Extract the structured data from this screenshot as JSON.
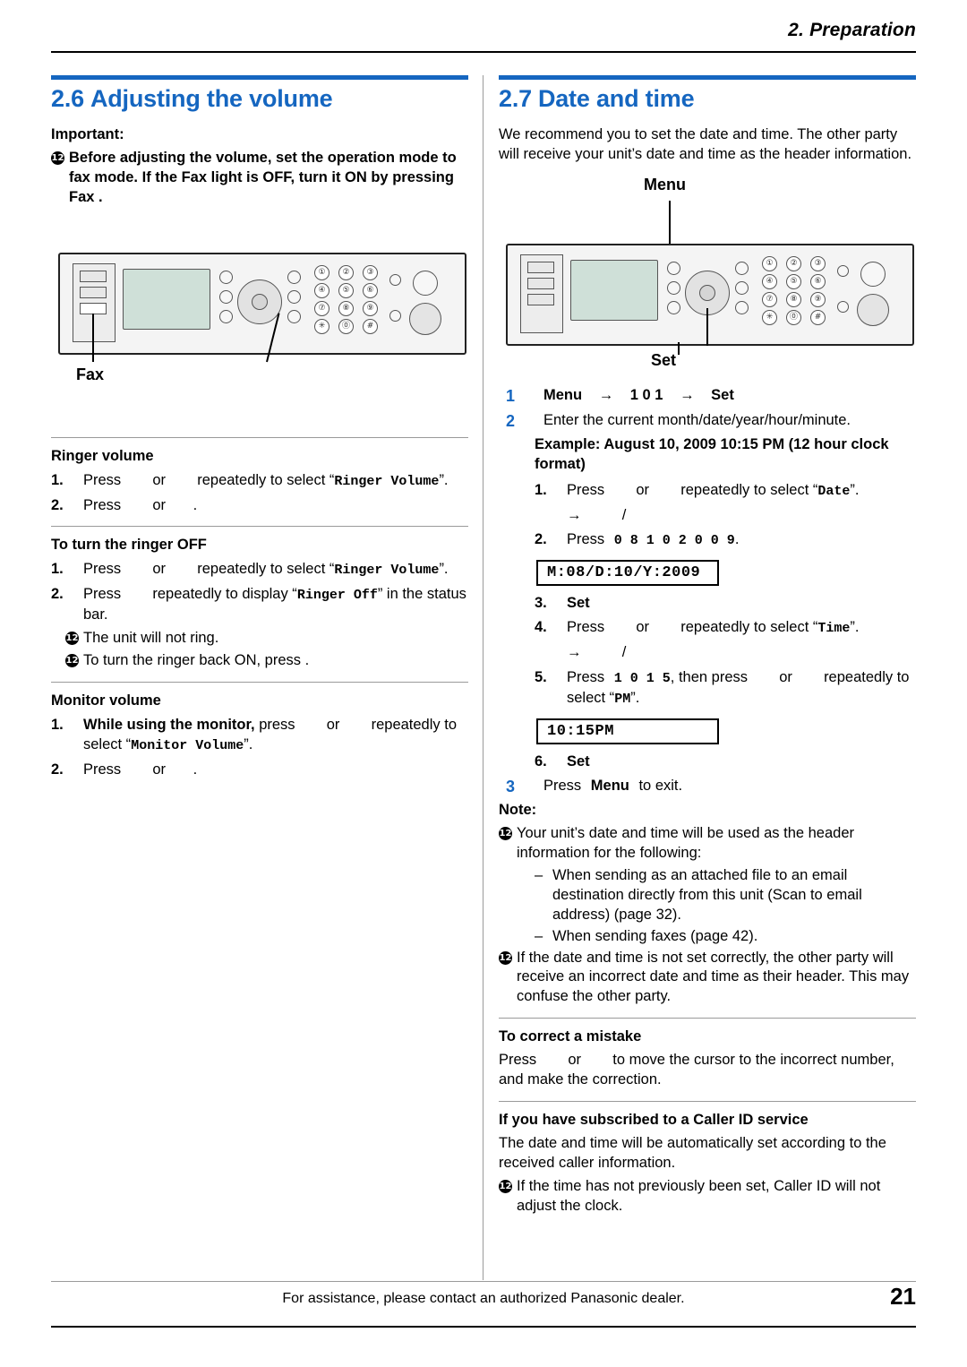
{
  "header": {
    "chapter": "2. Preparation"
  },
  "left": {
    "section": {
      "number": "2.6",
      "title": "Adjusting the volume"
    },
    "important_label": "Important:",
    "important_text": "Before adjusting the volume, set the operation mode to fax mode. If the  Fax  light is OFF, turn it ON by pressing  Fax .",
    "device_label": "Fax",
    "ringer_volume": {
      "heading": "Ringer volume",
      "step1": "Press        or        repeatedly to select “Ringer Volume”.",
      "step1_a": "Press",
      "step1_b": "or",
      "step1_c": "repeatedly to select “",
      "step1_mono": "Ringer Volume",
      "step1_d": "”.",
      "step2_a": "Press",
      "step2_b": "or",
      "step2_c": "."
    },
    "ringer_off": {
      "heading": "To turn the ringer OFF",
      "s1_a": "Press",
      "s1_b": "or",
      "s1_c": "repeatedly to select “",
      "s1_mono": "Ringer Volume",
      "s1_d": "”.",
      "s2_a": "Press",
      "s2_b": "repeatedly to display “",
      "s2_mono": "Ringer Off",
      "s2_c": "” in the status bar.",
      "note1": "The unit will not ring.",
      "note2": "To turn the ringer back ON, press        ."
    },
    "monitor_volume": {
      "heading": "Monitor volume",
      "s1_bold": "While using the monitor,",
      "s1_a": "press",
      "s1_b": "or",
      "s1_c": "repeatedly to select “",
      "s1_mono": "Monitor Volume",
      "s1_d": "”.",
      "s2_a": "Press",
      "s2_b": "or",
      "s2_c": "."
    }
  },
  "right": {
    "section": {
      "number": "2.7",
      "title": "Date and time"
    },
    "intro": "We recommend you to set the date and time. The other party will receive your unit’s date and time as the header information.",
    "device_label_top": "Menu",
    "device_label_bottom": "Set",
    "step1": {
      "num": "1",
      "menu": "Menu",
      "arrow1": "→",
      "digits": "1  0  1",
      "arrow2": "→",
      "set": "Set"
    },
    "step2": {
      "num": "2",
      "text": "Enter the current month/date/year/hour/minute."
    },
    "example": "Example: August 10, 2009 10:15 PM (12 hour clock format)",
    "sub1": {
      "n": "1.",
      "a": "Press",
      "b": "or",
      "c": "repeatedly to select “",
      "mono": "Date",
      "d": "”.",
      "arrow": "→",
      "slash": "/"
    },
    "sub2": {
      "n": "2.",
      "a": "Press",
      "mono": "0  8   1  0   2  0  0  9",
      "b": "."
    },
    "lcd1": "M:08/D:10/Y:2009",
    "sub3": {
      "n": "3.",
      "label": "Set"
    },
    "sub4": {
      "n": "4.",
      "a": "Press",
      "b": "or",
      "c": "repeatedly to select “",
      "mono": "Time",
      "d": "”.",
      "arrow": "→",
      "slash": "/"
    },
    "sub5": {
      "n": "5.",
      "a": "Press",
      "mono": "1  0   1  5",
      "b": ", then press",
      "c": "or",
      "d": "repeatedly to select “",
      "mono2": "PM",
      "e": "”."
    },
    "lcd2": "10:15PM",
    "sub6": {
      "n": "6.",
      "label": "Set"
    },
    "step3": {
      "num": "3",
      "a": "Press",
      "menu": "Menu",
      "b": "to exit."
    },
    "note_label": "Note:",
    "note1": "Your unit’s date and time will be used as the header information for the following:",
    "note1_dash1": "When sending as an attached file to an email destination directly from this unit (Scan to email address) (page 32).",
    "note1_dash2": "When sending faxes (page 42).",
    "note2": "If the date and time is not set correctly, the other party will receive an incorrect date and time as their header. This may confuse the other party.",
    "correct_heading": "To correct a mistake",
    "correct_a": "Press",
    "correct_b": "or",
    "correct_c": "to move the cursor to the incorrect number, and make the correction.",
    "callerid_heading": "If you have subscribed to a Caller ID service",
    "callerid_text": "The date and time will be automatically set according to the received caller information.",
    "callerid_note": "If the time has not previously been set, Caller ID will not adjust the clock."
  },
  "footer": {
    "text": "For assistance, please contact an authorized Panasonic dealer.",
    "page": "21"
  },
  "keypad": {
    "rows": [
      [
        "①",
        "②",
        "③"
      ],
      [
        "④",
        "⑤",
        "⑥"
      ],
      [
        "⑦",
        "⑧",
        "⑨"
      ],
      [
        "✳",
        "⓪",
        "#"
      ]
    ]
  },
  "colors": {
    "accent": "#1566c0",
    "rule": "#9a9a9a"
  }
}
